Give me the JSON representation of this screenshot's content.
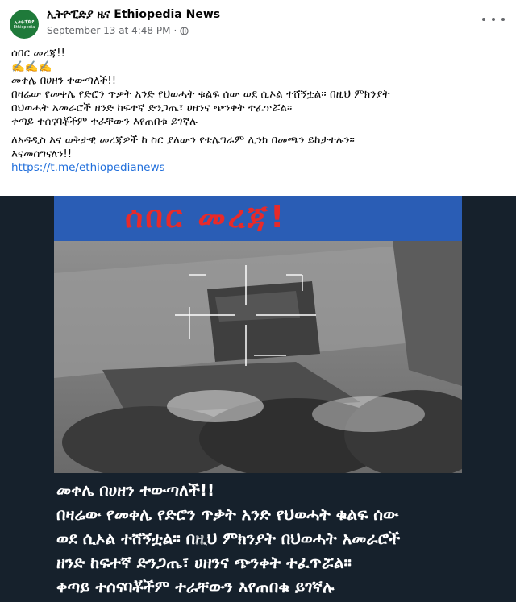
{
  "post": {
    "page_name": "ኢትዮፒድያ ዜና Ethiopedia News",
    "avatar_text_top": "ኢትዮፒድያ",
    "avatar_text_bottom": "Ethiopedia",
    "timestamp": "September 13 at 4:48 PM",
    "separator": "·",
    "icons": {
      "privacy": "globe-icon",
      "menu": "more-options-icon"
    },
    "text_lines": [
      "ሰበር መረጃ!!",
      "✍️✍️✍️",
      "መቀሌ በሀዘን ተውጣለች!!",
      "በዛሬው የመቀሌ የድሮን ጥቃት አንድ የህወሓት ቁልፍ ሰው ወደ ሲኦል ተሸኝቷል። በዚህ ምክንያት",
      "በህወሓት አመራሮች ዘንድ ከፍተኛ ድንጋጤ፣ ሀዘንና ጭንቀት ተፈጥሯል።",
      "ቀጣይ ተሰናባቾችም ተራቸውን እየጠበቁ ይገኛሉ"
    ],
    "text_lines_2": [
      "ለአዳዲስ እና ወቅታዊ መረጃዎች ከ ስር ያለውን የቴሌግራም ሊንክ በመጫን ይከታተሉን።",
      "እናመሰግናለን!!"
    ],
    "link": "https://t.me/ethiopedianews"
  },
  "image": {
    "banner_title": "ሰበር መረጃ!",
    "caption_lines": [
      "መቀሌ በሀዘን ተውጣለች!!",
      "በዛሬው የመቀሌ የድሮን ጥቃት አንድ የህወሓት ቁልፍ ሰው",
      "ወደ ሲኦል ተሸኝቷል። በዚህ ምክንያት በህወሓት አመራሮች",
      "ዘንድ ከፍተኛ ድንጋጤ፣ ሀዘንና ጭንቀት ተፈጥሯል።",
      "ቀጣይ ተሰናባቾችም ተራቸውን እየጠበቁ ይገኛሉ"
    ],
    "colors": {
      "banner_bg": "#2a5db5",
      "banner_text": "#e82a2a",
      "image_bg": "#16212c"
    }
  }
}
